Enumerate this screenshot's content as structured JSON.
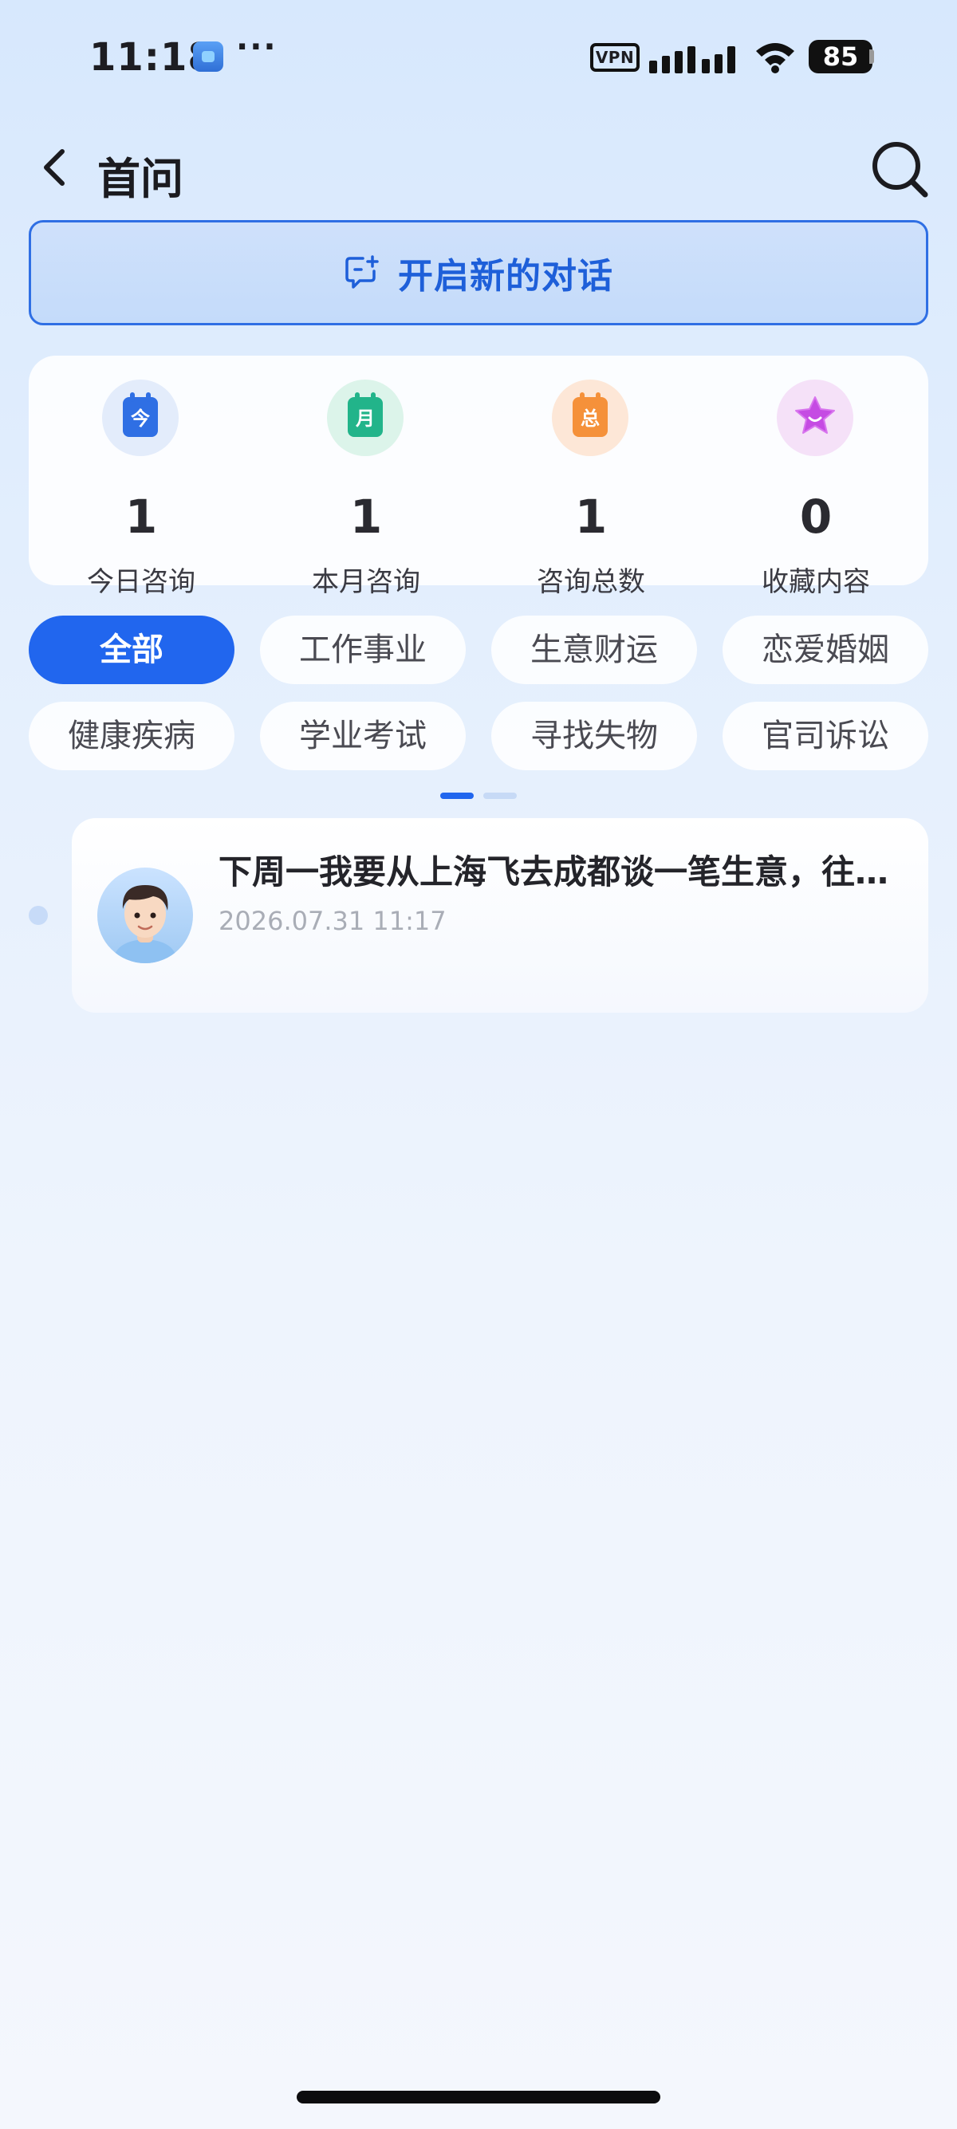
{
  "status_bar": {
    "time": "11:18",
    "more": "···",
    "vpn": "VPN",
    "battery": "85"
  },
  "header": {
    "title": "首问",
    "back_icon": "chevron-left-icon",
    "search_icon": "search-icon"
  },
  "new_chat": {
    "label": "开启新的对话",
    "icon": "chat-plus-icon"
  },
  "stats": [
    {
      "value": "1",
      "label": "今日咨询",
      "icon_text": "今",
      "icon": "calendar-today-icon",
      "color": "#2f6fe4",
      "bg": "#e3ecfb"
    },
    {
      "value": "1",
      "label": "本月咨询",
      "icon_text": "月",
      "icon": "calendar-month-icon",
      "color": "#22b48a",
      "bg": "#dcf4ea"
    },
    {
      "value": "1",
      "label": "咨询总数",
      "icon_text": "总",
      "icon": "calendar-total-icon",
      "color": "#f5913a",
      "bg": "#fde7d7"
    },
    {
      "value": "0",
      "label": "收藏内容",
      "icon_text": "",
      "icon": "star-icon",
      "color": "#c54be3",
      "bg": "#f5e1f8"
    }
  ],
  "categories": [
    "全部",
    "工作事业",
    "生意财运",
    "恋爱婚姻",
    "健康疾病",
    "学业考试",
    "寻找失物",
    "官司诉讼"
  ],
  "active_category": "全部",
  "history": [
    {
      "title": "下周一我要从上海飞去成都谈一笔生意，往…",
      "time": "2026.07.31 11:17"
    }
  ],
  "colors": {
    "accent": "#2166ee",
    "accent_text": "#1e5fd9"
  }
}
